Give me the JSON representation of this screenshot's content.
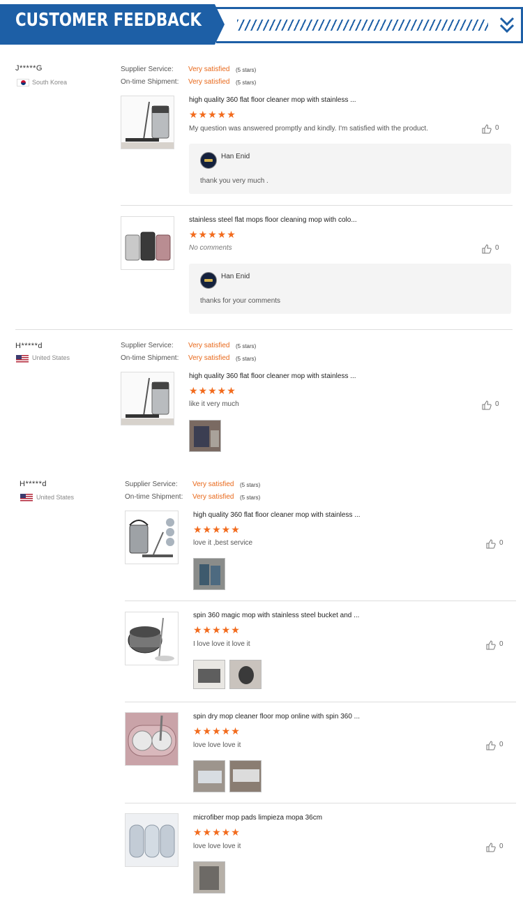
{
  "header": {
    "title": "CUSTOMER FEEDBACK"
  },
  "labels": {
    "supplier_service": "Supplier Service:",
    "ontime_shipment": "On-time Shipment:",
    "very_satisfied": "Very satisfied",
    "five_stars": "(5 stars)"
  },
  "stars": "★★★★★",
  "reviews": [
    {
      "user": "J*****G",
      "country": "South Korea",
      "items": [
        {
          "title": "high quality 360 flat floor cleaner mop with stainless ...",
          "comment": "My question was answered promptly and kindly. I'm satisfied with the product.",
          "likes": "0",
          "reply": {
            "seller": "Han Enid",
            "text": "thank you very much ."
          }
        },
        {
          "title": "stainless steel flat mops floor cleaning mop with colo...",
          "comment": "No comments",
          "likes": "0",
          "reply": {
            "seller": "Han Enid",
            "text": "thanks for your comments"
          }
        }
      ]
    },
    {
      "user": "H*****d",
      "country": "United States",
      "items": [
        {
          "title": "high quality 360 flat floor cleaner mop with stainless ...",
          "comment": "like it very much",
          "likes": "0"
        }
      ]
    },
    {
      "user": "H*****d",
      "country": "United States",
      "items": [
        {
          "title": "high quality 360 flat floor cleaner mop with stainless ...",
          "comment": "love it ,best service",
          "likes": "0"
        },
        {
          "title": "spin 360 magic mop with stainless steel bucket and ...",
          "comment": "I love love it love it",
          "likes": "0"
        },
        {
          "title": "spin dry mop cleaner floor mop online with spin 360 ...",
          "comment": "love love love it",
          "likes": "0"
        },
        {
          "title": "microfiber mop pads limpieza mopa 36cm",
          "comment": "love love love it",
          "likes": "0"
        }
      ]
    }
  ],
  "icons": {
    "like": "thumbs-up-icon",
    "expand": "chevron-double-down-icon"
  },
  "colors": {
    "brand": "#1d5fa6",
    "accent": "#f26b1d",
    "satisfied": "#e8681a"
  }
}
